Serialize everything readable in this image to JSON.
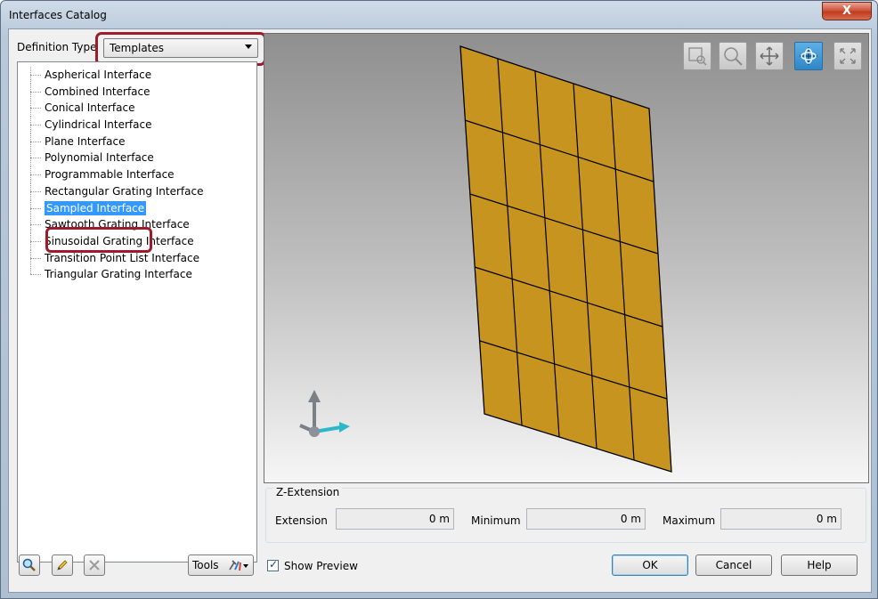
{
  "window": {
    "title": "Interfaces Catalog",
    "close_label": "X"
  },
  "definition": {
    "label": "Definition Type",
    "value": "Templates"
  },
  "tree": {
    "items": [
      "Aspherical Interface",
      "Combined Interface",
      "Conical Interface",
      "Cylindrical Interface",
      "Plane Interface",
      "Polynomial Interface",
      "Programmable Interface",
      "Rectangular Grating Interface",
      "Sampled Interface",
      "Sawtooth Grating Interface",
      "Sinusoidal Grating Interface",
      "Transition Point List Interface",
      "Triangular Grating Interface"
    ],
    "selected": "Sampled Interface"
  },
  "viewport": {
    "tools": [
      "zoom-window-icon",
      "zoom-icon",
      "pan-icon",
      "rotate-icon",
      "fit-view-icon"
    ],
    "active_tool": "rotate-icon",
    "surface_color": "#c89420",
    "highlight_color": "#9e1b2c"
  },
  "z_extension": {
    "title": "Z-Extension",
    "extension_label": "Extension",
    "extension_value": "0 m",
    "minimum_label": "Minimum",
    "minimum_value": "0 m",
    "maximum_label": "Maximum",
    "maximum_value": "0 m"
  },
  "footer": {
    "tools_label": "Tools",
    "show_preview_label": "Show Preview",
    "ok_label": "OK",
    "cancel_label": "Cancel",
    "help_label": "Help"
  }
}
